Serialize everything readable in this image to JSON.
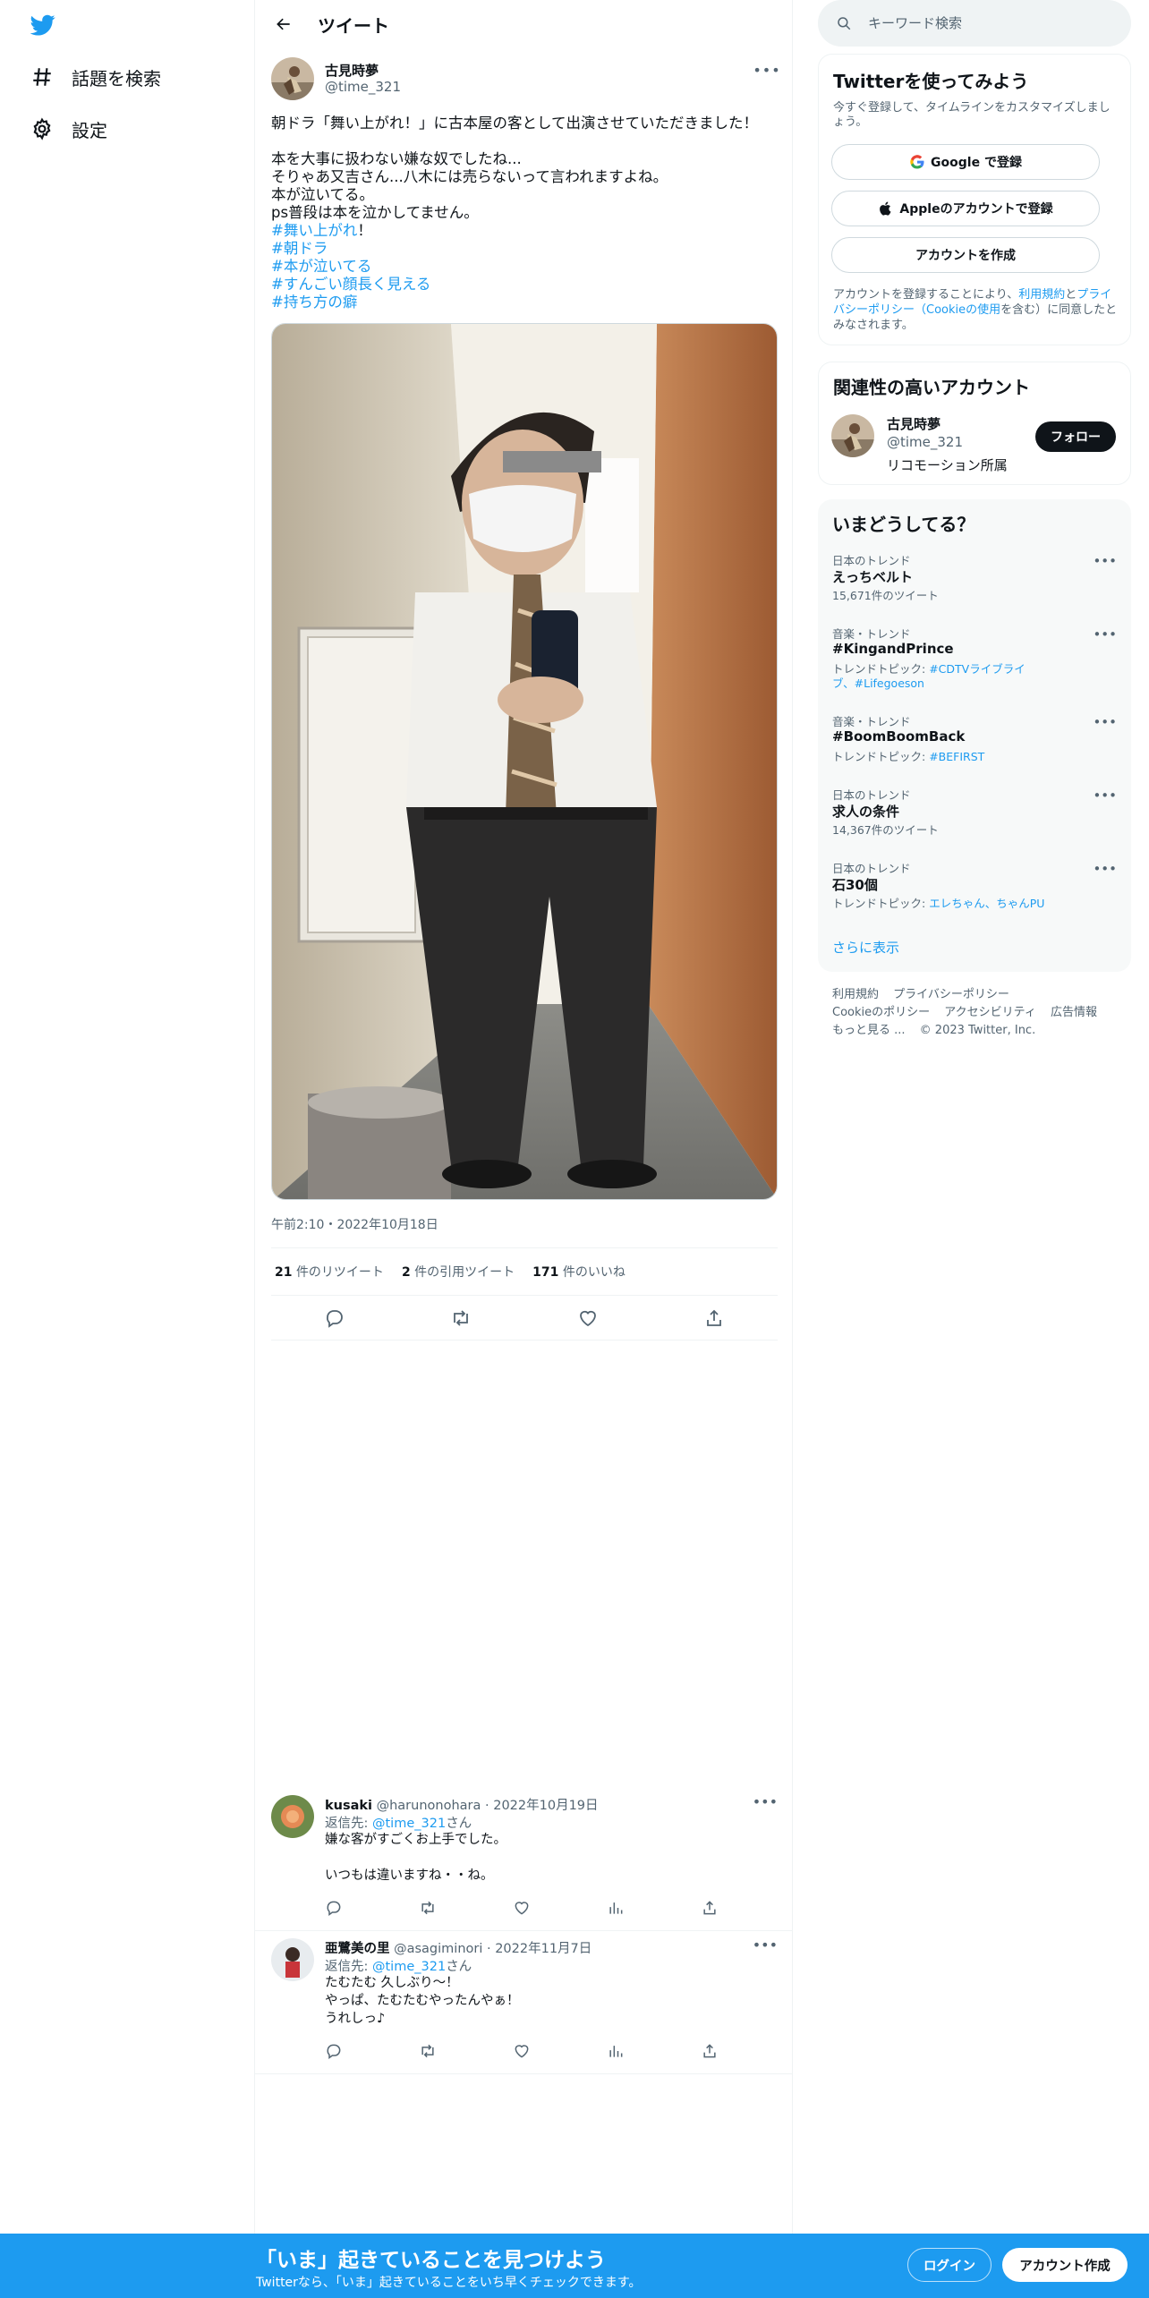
{
  "left_nav": {
    "logo": "twitter-bird-icon",
    "items": [
      {
        "label": "話題を検索",
        "icon": "hashtag-icon"
      },
      {
        "label": "設定",
        "icon": "gear-icon"
      }
    ]
  },
  "header": {
    "title": "ツイート"
  },
  "tweet": {
    "author": {
      "name": "古見時夢",
      "handle": "@time_321"
    },
    "text_lines": [
      "朝ドラ「舞い上がれ！」に古本屋の客として出演させていただきました！",
      "",
      "本を大事に扱わない嫌な奴でしたね...",
      "そりゃあ又吉さん...八木には売らないって言われますよね。",
      "本が泣いてる。",
      "ps普段は本を泣かしてません。"
    ],
    "hashtags": [
      {
        "tag": "#舞い上がれ",
        "suffix": "！"
      },
      {
        "tag": "#朝ドラ",
        "suffix": ""
      },
      {
        "tag": "#本が泣いてる",
        "suffix": ""
      },
      {
        "tag": "#すんごい顔長く見える",
        "suffix": ""
      },
      {
        "tag": "#持ち方の癖",
        "suffix": ""
      }
    ],
    "timestamp": "午前2:10・2022年10月18日",
    "stats": {
      "retweets": "21",
      "retweets_label": "件のリツイート",
      "quotes": "2",
      "quotes_label": "件の引用ツイート",
      "likes": "171",
      "likes_label": "件のいいね"
    }
  },
  "replies": [
    {
      "name": "kusaki",
      "handle": "@harunonohara",
      "date": "2022年10月19日",
      "reply_to_prefix": "返信先: ",
      "reply_to": "@time_321",
      "reply_to_suffix": "さん",
      "lines": [
        "嫌な客がすごくお上手でした。",
        "",
        "いつもは違いますね・・ね。"
      ]
    },
    {
      "name": "亜鷺美の里",
      "handle": "@asagiminori",
      "date": "2022年11月7日",
      "reply_to_prefix": "返信先: ",
      "reply_to": "@time_321",
      "reply_to_suffix": "さん",
      "lines": [
        "たむたむ 久しぶり〜！",
        "やっぱ、たむたむやったんやぁ！",
        "うれしっ♪"
      ]
    }
  ],
  "search": {
    "placeholder": "キーワード検索"
  },
  "signup": {
    "title": "Twitterを使ってみよう",
    "subtitle": "今すぐ登録して、タイムラインをカスタマイズしましょう。",
    "google_button": "Google で登録",
    "apple_button": "Appleのアカウントで登録",
    "create_button": "アカウントを作成",
    "legal_prefix": "アカウントを登録することにより、",
    "legal_terms": "利用規約",
    "legal_and": "と",
    "legal_privacy": "プライバシーポリシー",
    "legal_mid": "（",
    "legal_cookie": "Cookieの使用",
    "legal_suffix": "を含む）に同意したとみなされます。"
  },
  "related": {
    "title": "関連性の高いアカウント",
    "name": "古見時夢",
    "handle": "@time_321",
    "bio": "リコモーション所属",
    "follow": "フォロー"
  },
  "trends": {
    "title": "いまどうしてる？",
    "items": [
      {
        "category": "日本のトレンド",
        "name": "えっちベルト",
        "meta": "15,671件のツイート",
        "topic_prefix": "",
        "topic": ""
      },
      {
        "category": "音楽・トレンド",
        "name": "#KingandPrince",
        "meta": "",
        "topic_prefix": "トレンドトピック: ",
        "topic": "#CDTVライブライブ、#Lifegoeson"
      },
      {
        "category": "音楽・トレンド",
        "name": "#BoomBoomBack",
        "meta": "",
        "topic_prefix": "トレンドトピック: ",
        "topic": "#BEFIRST"
      },
      {
        "category": "日本のトレンド",
        "name": "求人の条件",
        "meta": "14,367件のツイート",
        "topic_prefix": "",
        "topic": ""
      },
      {
        "category": "日本のトレンド",
        "name": "石30個",
        "meta": "",
        "topic_prefix": "トレンドトピック: ",
        "topic": "エレちゃん、ちゃんPU"
      }
    ],
    "show_more": "さらに表示"
  },
  "footer": {
    "links": [
      "利用規約",
      "プライバシーポリシー",
      "Cookieのポリシー",
      "アクセシビリティ",
      "広告情報",
      "もっと見る ...",
      "© 2023 Twitter, Inc."
    ]
  },
  "bottom_bar": {
    "title": "「いま」起きていることを見つけよう",
    "subtitle": "Twitterなら、「いま」起きていることをいち早くチェックできます。",
    "login": "ログイン",
    "signup": "アカウント作成"
  },
  "colors": {
    "accent": "#1d9bf0",
    "text": "#0f1419",
    "muted": "#536471"
  }
}
